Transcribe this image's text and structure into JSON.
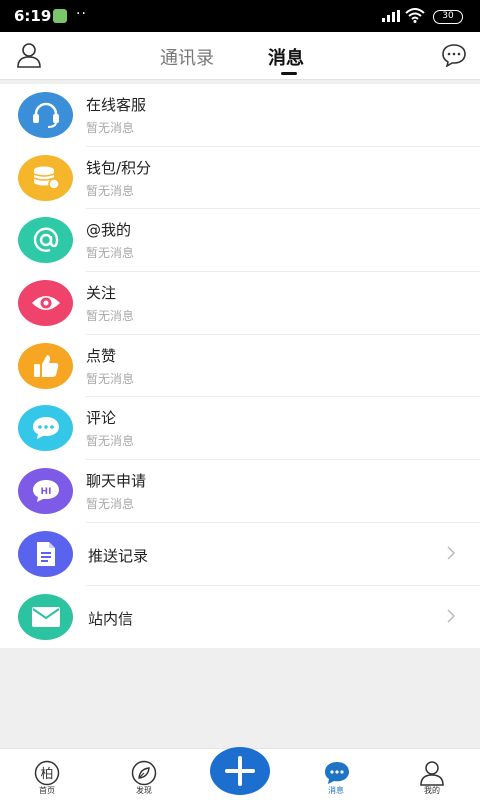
{
  "status_bar": {
    "time": "6:19",
    "battery": "30"
  },
  "header": {
    "tabs": [
      {
        "label": "通讯录"
      },
      {
        "label": "消息"
      }
    ],
    "active_tab": "消息"
  },
  "messages": [
    {
      "title": "在线客服",
      "subtitle": "暂无消息",
      "icon": "headset-icon",
      "color": "#3a8fd8"
    },
    {
      "title": "钱包/积分",
      "subtitle": "暂无消息",
      "icon": "coins-icon",
      "color": "#f5b62c"
    },
    {
      "title": "@我的",
      "subtitle": "暂无消息",
      "icon": "at-sign-icon",
      "color": "#2ec9a6"
    },
    {
      "title": "关注",
      "subtitle": "暂无消息",
      "icon": "eye-icon",
      "color": "#f0436b"
    },
    {
      "title": "点赞",
      "subtitle": "暂无消息",
      "icon": "thumbs-up-icon",
      "color": "#f7a623"
    },
    {
      "title": "评论",
      "subtitle": "暂无消息",
      "icon": "comment-icon",
      "color": "#35c7e8"
    },
    {
      "title": "聊天申请",
      "subtitle": "暂无消息",
      "icon": "hi-chat-icon",
      "color": "#7d5be6"
    }
  ],
  "links": [
    {
      "title": "推送记录",
      "icon": "document-icon",
      "color": "#5963ee"
    },
    {
      "title": "站内信",
      "icon": "envelope-icon",
      "color": "#2bc3a0"
    }
  ],
  "bottom_nav": [
    {
      "label": "首页",
      "icon": "home-logo-icon"
    },
    {
      "label": "发现",
      "icon": "compass-icon"
    },
    {
      "label": "消息",
      "icon": "message-icon",
      "active": true
    },
    {
      "label": "我的",
      "icon": "profile-icon"
    }
  ],
  "colors": {
    "accent": "#1c6fcf",
    "active_nav": "#1d73c4"
  }
}
